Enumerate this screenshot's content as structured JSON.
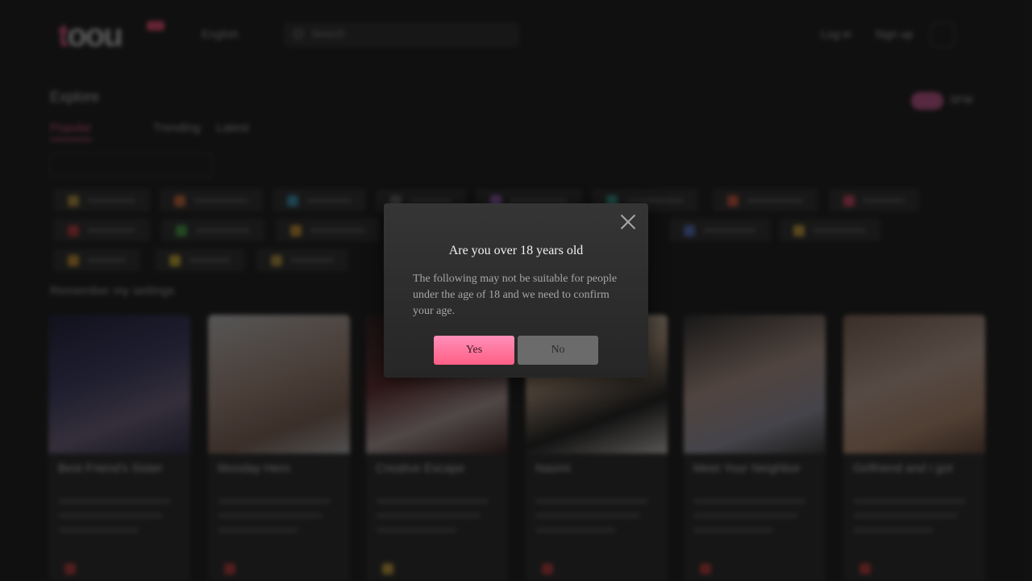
{
  "background": {
    "logo_text": "toou",
    "language": "English",
    "search_placeholder": "Search",
    "login_label": "Log in",
    "signup_label": "Sign up",
    "section_title": "Explore",
    "toggle_label": "SFW",
    "tabs": [
      "Popular",
      "Trending",
      "Latest"
    ],
    "remember_label": "Remember my settings",
    "chip_colors": [
      "#c9a23a",
      "#e0703a",
      "#3aa0c9",
      "#777777",
      "#b06bd0",
      "#3ab0a0",
      "#e05a3a",
      "#e0456a",
      "#d03a3a",
      "#4ab04a",
      "#e0a030",
      "#5a7ad0",
      "#e0b03a",
      "#e0a030",
      "#e0c030"
    ],
    "cards": [
      {
        "title": "Best Friend's Sister",
        "tag_color": "#d03a3a"
      },
      {
        "title": "Monday Hero",
        "tag_color": "#d03a3a"
      },
      {
        "title": "Creative Escape",
        "tag_color": "#e0b03a"
      },
      {
        "title": "Naomi",
        "tag_color": "#d03a3a"
      },
      {
        "title": "Meet Your Neighbor",
        "tag_color": "#d03a3a"
      },
      {
        "title": "Girlfriend and I got",
        "tag_color": "#d03a3a"
      }
    ]
  },
  "modal": {
    "title": "Are you over 18 years old",
    "message": "The following may not be suitable for people under the age of 18 and we need to confirm your age.",
    "yes_label": "Yes",
    "no_label": "No"
  }
}
